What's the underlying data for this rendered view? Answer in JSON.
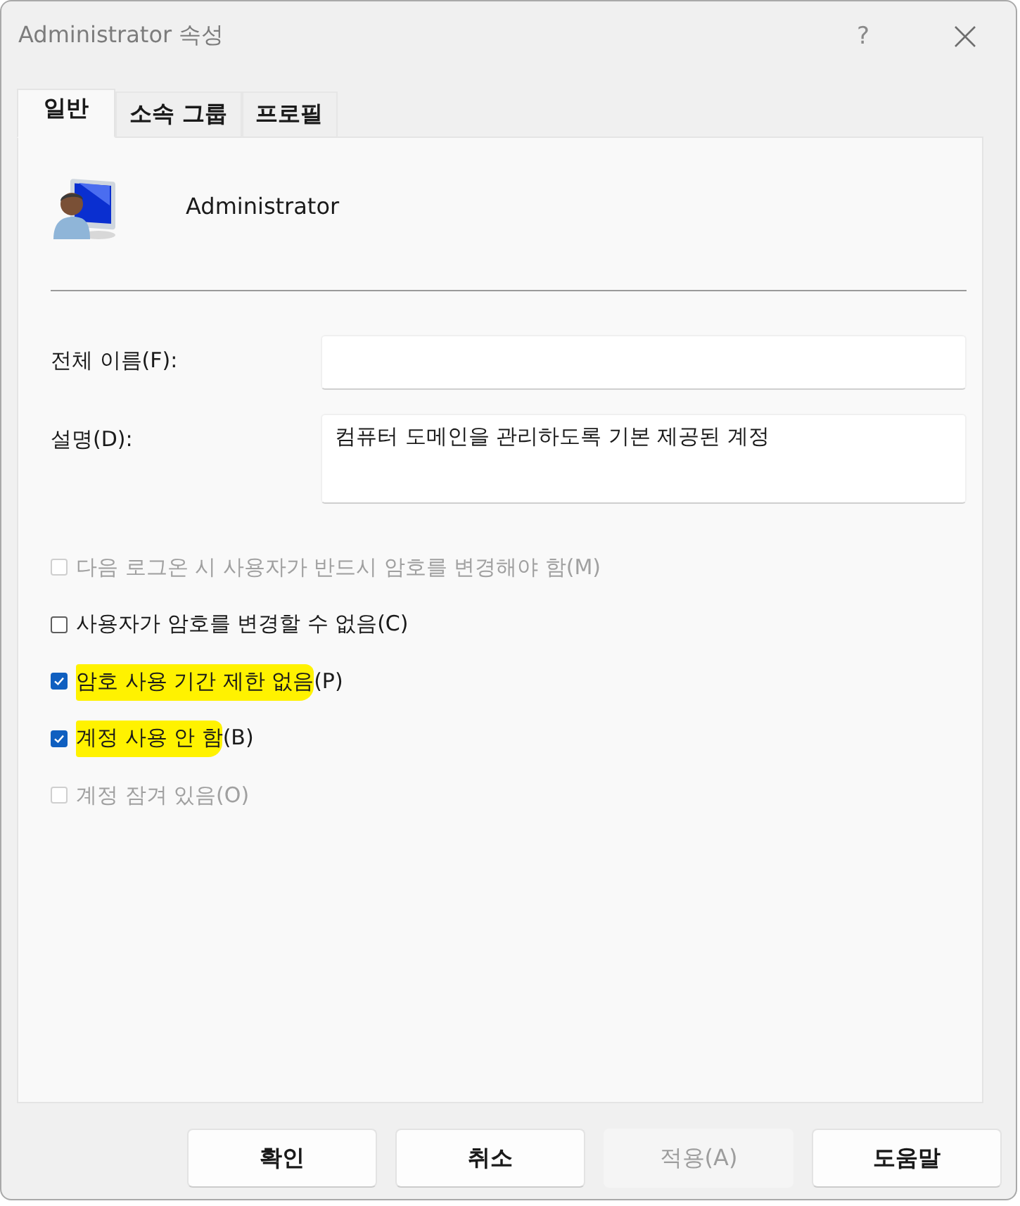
{
  "window": {
    "title": "Administrator 속성",
    "help": "?"
  },
  "tabs": [
    {
      "label": "일반",
      "selected": true
    },
    {
      "label": "소속 그룹",
      "selected": false
    },
    {
      "label": "프로필",
      "selected": false
    }
  ],
  "account": {
    "name": "Administrator"
  },
  "fields": [
    {
      "kind": "line",
      "label": "전체 이름(F):"
    },
    {
      "kind": "multiline",
      "label": "설명(D):",
      "value": "컴퓨터 도메인을 관리하도록 기본 제공된 계정"
    }
  ],
  "options": [
    {
      "label": "다음 로그온 시 사용자가 반드시 암호를 변경해야 함",
      "shortcut": "(M)",
      "checked": false,
      "disabled": true,
      "highlighted": false
    },
    {
      "label": "사용자가 암호를 변경할 수 없음",
      "shortcut": "(C)",
      "checked": false,
      "disabled": false,
      "highlighted": false
    },
    {
      "label": "암호 사용 기간 제한 없음",
      "shortcut": "(P)",
      "checked": true,
      "disabled": false,
      "highlighted": true
    },
    {
      "label": "계정 사용 안 함",
      "shortcut": "(B)",
      "checked": true,
      "disabled": false,
      "highlighted": true
    },
    {
      "label": "계정 잠겨 있음",
      "shortcut": "(O)",
      "checked": false,
      "disabled": true,
      "highlighted": false
    }
  ],
  "buttons": [
    {
      "label": "확인",
      "disabled": false
    },
    {
      "label": "취소",
      "disabled": false
    },
    {
      "label": "적용(A)",
      "disabled": true
    },
    {
      "label": "도움말",
      "disabled": false
    }
  ]
}
